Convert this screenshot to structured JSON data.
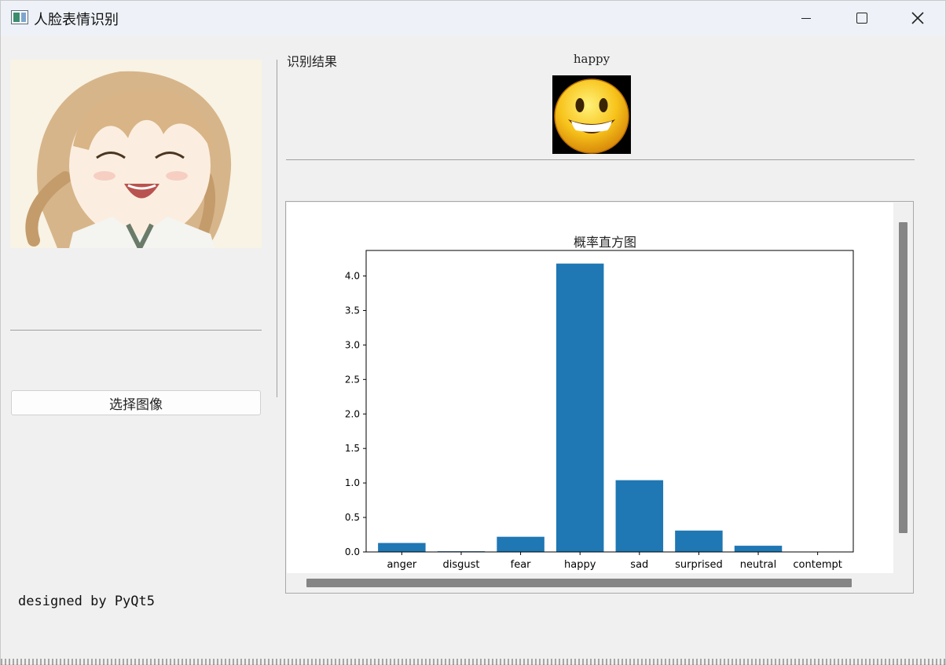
{
  "window": {
    "title": "人脸表情识别",
    "controls": {
      "minimize": "minimize",
      "maximize": "maximize",
      "close": "close"
    }
  },
  "left_panel": {
    "select_button_label": "选择图像",
    "credit": "designed by PyQt5"
  },
  "right_panel": {
    "result_label": "识别结果",
    "emotion_name": "happy",
    "emoji_icon": "smiling-face-emoji"
  },
  "colors": {
    "bar": "#1f77b4",
    "titlebar": "#eef2f8"
  },
  "chart_data": {
    "type": "bar",
    "title": "概率直方图",
    "xlabel": "",
    "ylabel": "",
    "categories": [
      "anger",
      "disgust",
      "fear",
      "happy",
      "sad",
      "surprised",
      "neutral",
      "contempt"
    ],
    "values": [
      0.13,
      0.01,
      0.22,
      4.18,
      1.04,
      0.31,
      0.09,
      0.0
    ],
    "ylim": [
      0,
      4.37
    ],
    "yticks": [
      "0.0",
      "0.5",
      "1.0",
      "1.5",
      "2.0",
      "2.5",
      "3.0",
      "3.5",
      "4.0"
    ],
    "grid": false
  }
}
